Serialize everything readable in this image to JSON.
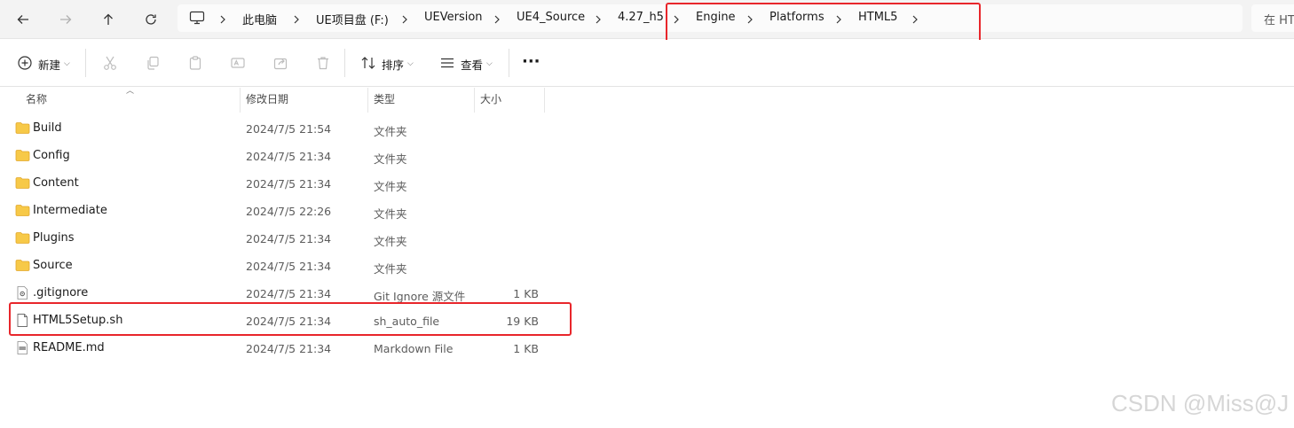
{
  "nav": {
    "back_icon": "arrow-left-icon",
    "forward_icon": "arrow-right-icon",
    "up_icon": "arrow-up-icon",
    "refresh_icon": "refresh-icon"
  },
  "breadcrumb": [
    "此电脑",
    "UE项目盘 (F:)",
    "UEVersion",
    "UE4_Source",
    "4.27_h5",
    "Engine",
    "Platforms",
    "HTML5"
  ],
  "search": {
    "placeholder": "在 HT"
  },
  "toolbar": {
    "new_label": "新建",
    "sort_label": "排序",
    "view_label": "查看",
    "more_label": "···"
  },
  "columns": {
    "name": "名称",
    "date": "修改日期",
    "type": "类型",
    "size": "大小"
  },
  "files": [
    {
      "name": "Build",
      "date": "2024/7/5 21:54",
      "type": "文件夹",
      "size": "",
      "icon": "folder-icon"
    },
    {
      "name": "Config",
      "date": "2024/7/5 21:34",
      "type": "文件夹",
      "size": "",
      "icon": "folder-icon"
    },
    {
      "name": "Content",
      "date": "2024/7/5 21:34",
      "type": "文件夹",
      "size": "",
      "icon": "folder-icon"
    },
    {
      "name": "Intermediate",
      "date": "2024/7/5 22:26",
      "type": "文件夹",
      "size": "",
      "icon": "folder-icon"
    },
    {
      "name": "Plugins",
      "date": "2024/7/5 21:34",
      "type": "文件夹",
      "size": "",
      "icon": "folder-icon"
    },
    {
      "name": "Source",
      "date": "2024/7/5 21:34",
      "type": "文件夹",
      "size": "",
      "icon": "folder-icon"
    },
    {
      "name": ".gitignore",
      "date": "2024/7/5 21:34",
      "type": "Git Ignore 源文件",
      "size": "1 KB",
      "icon": "gear-file-icon"
    },
    {
      "name": "HTML5Setup.sh",
      "date": "2024/7/5 21:34",
      "type": "sh_auto_file",
      "size": "19 KB",
      "icon": "blank-file-icon"
    },
    {
      "name": "README.md",
      "date": "2024/7/5 21:34",
      "type": "Markdown File",
      "size": "1 KB",
      "icon": "markdown-file-icon"
    }
  ],
  "colors": {
    "highlight": "#e8262b",
    "folder": "#f7c948",
    "folder_dark": "#e2a72b"
  },
  "watermark": "CSDN @Miss@J"
}
